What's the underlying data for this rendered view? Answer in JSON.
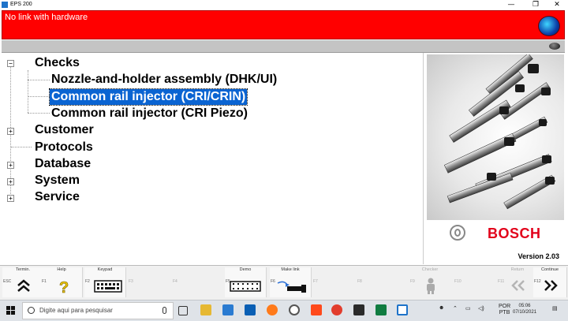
{
  "window": {
    "title": "EPS 200",
    "controls": {
      "minimize": "—",
      "restore": "❐",
      "close": "✕"
    }
  },
  "status": {
    "text": "No link with hardware",
    "bar_color": "#ff0000"
  },
  "tree": {
    "items": [
      {
        "label": "Checks",
        "expander": "−"
      },
      {
        "label": "Nozzle-and-holder assembly (DHK/UI)"
      },
      {
        "label": "Common rail injector (CRI/CRIN)",
        "selected": true
      },
      {
        "label": "Common rail injector (CRI Piezo)"
      },
      {
        "label": "Customer",
        "expander": "+"
      },
      {
        "label": "Protocols"
      },
      {
        "label": "Database",
        "expander": "+"
      },
      {
        "label": "System",
        "expander": "+"
      },
      {
        "label": "Service",
        "expander": "+"
      }
    ],
    "selection_color": "#0a64d2"
  },
  "side_panel": {
    "brand": "BOSCH",
    "brand_color": "#e2001a",
    "version": "Version 2.03"
  },
  "fkeys": [
    {
      "label": "Termin.",
      "key": "ESC",
      "icon": "double-chevron-up-icon",
      "enabled": true
    },
    {
      "label": "Help",
      "key": "F1",
      "icon": "question-mark-icon",
      "enabled": true
    },
    {
      "label": "Keypad",
      "key": "F2",
      "icon": "keypad-icon",
      "enabled": true
    },
    {
      "label": "",
      "key": "F3",
      "enabled": false
    },
    {
      "label": "",
      "key": "F4",
      "enabled": false
    },
    {
      "label": "Demo",
      "key": "F5",
      "icon": "film-strip-icon",
      "enabled": true
    },
    {
      "label": "Make link",
      "key": "F6",
      "icon": "cable-connector-icon",
      "enabled": true
    },
    {
      "label": "",
      "key": "F7",
      "enabled": false
    },
    {
      "label": "",
      "key": "F8",
      "enabled": false
    },
    {
      "label": "Checker",
      "key": "F9",
      "icon": "person-icon",
      "enabled": false
    },
    {
      "label": "",
      "key": "F10",
      "enabled": false
    },
    {
      "label": "Return",
      "key": "F11",
      "icon": "double-chevron-left-icon",
      "enabled": false
    },
    {
      "label": "Continue",
      "key": "F12",
      "icon": "double-chevron-right-icon",
      "enabled": true
    }
  ],
  "taskbar": {
    "search_placeholder": "Digite aqui para pesquisar",
    "language": "POR",
    "layout": "PTB",
    "time": "05:06",
    "date": "07/10/2021"
  }
}
